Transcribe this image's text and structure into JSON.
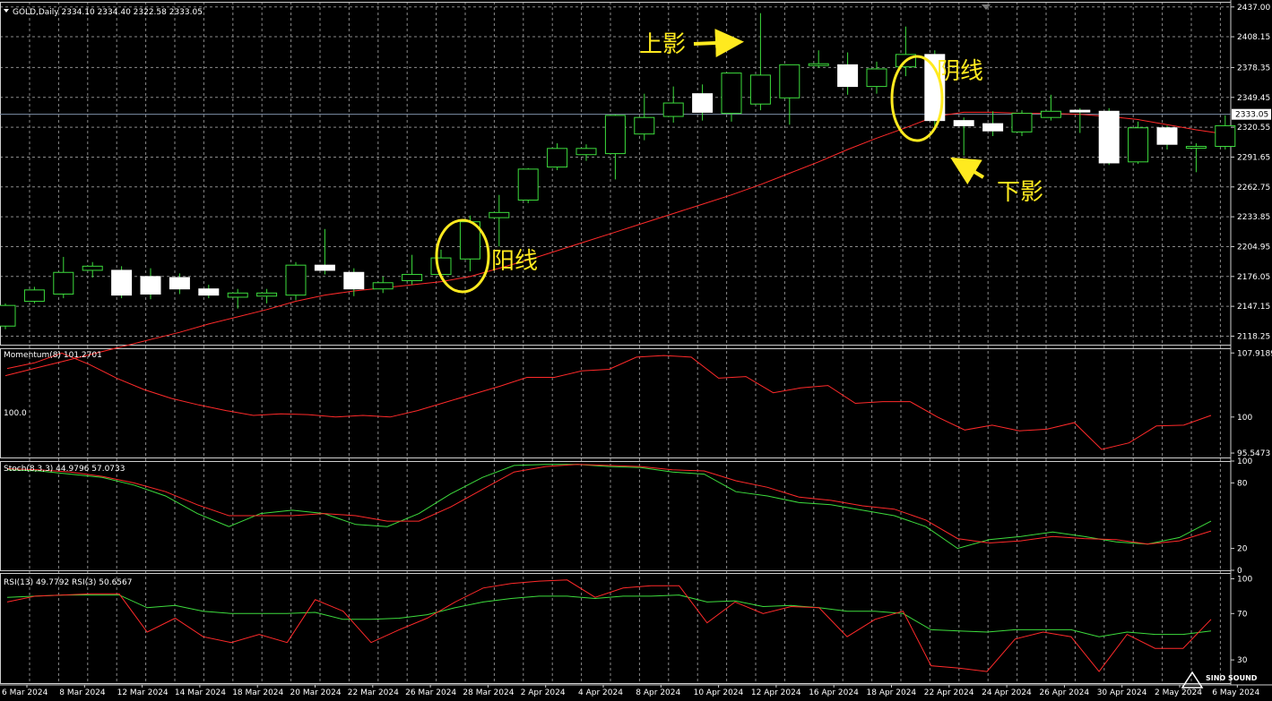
{
  "watermark": "SINO SOUND",
  "chart_data": [
    {
      "type": "candlestick",
      "title": "GOLD,Daily  2334.10 2334.40 2322.58 2333.05",
      "current_price": 2333.05,
      "current_price_label": "2333.05",
      "ylim": [
        2110,
        2442
      ],
      "yticks": [
        "2437.00",
        "2408.15",
        "2378.35",
        "2349.45",
        "2320.55",
        "2291.65",
        "2262.75",
        "2233.85",
        "2204.95",
        "2176.05",
        "2147.15",
        "2118.25"
      ],
      "x_labels": [
        "6 Mar 2024",
        "8 Mar 2024",
        "12 Mar 2024",
        "14 Mar 2024",
        "18 Mar 2024",
        "20 Mar 2024",
        "22 Mar 2024",
        "26 Mar 2024",
        "28 Mar 2024",
        "2 Apr 2024",
        "4 Apr 2024",
        "8 Apr 2024",
        "10 Apr 2024",
        "12 Apr 2024",
        "16 Apr 2024",
        "18 Apr 2024",
        "22 Apr 2024",
        "24 Apr 2024",
        "26 Apr 2024",
        "30 Apr 2024",
        "2 May 2024",
        "6 May 2024"
      ],
      "candles": [
        {
          "o": 2128,
          "h": 2150,
          "l": 2125,
          "c": 2148
        },
        {
          "o": 2152,
          "h": 2166,
          "l": 2150,
          "c": 2163
        },
        {
          "o": 2159,
          "h": 2195,
          "l": 2155,
          "c": 2180
        },
        {
          "o": 2182,
          "h": 2190,
          "l": 2175,
          "c": 2186
        },
        {
          "o": 2182,
          "h": 2186,
          "l": 2155,
          "c": 2158
        },
        {
          "o": 2176,
          "h": 2184,
          "l": 2154,
          "c": 2159
        },
        {
          "o": 2175,
          "h": 2179,
          "l": 2159,
          "c": 2164
        },
        {
          "o": 2164,
          "h": 2168,
          "l": 2155,
          "c": 2158
        },
        {
          "o": 2156,
          "h": 2164,
          "l": 2145,
          "c": 2160
        },
        {
          "o": 2157,
          "h": 2164,
          "l": 2150,
          "c": 2160
        },
        {
          "o": 2158,
          "h": 2190,
          "l": 2153,
          "c": 2187
        },
        {
          "o": 2187,
          "h": 2222,
          "l": 2178,
          "c": 2182
        },
        {
          "o": 2180,
          "h": 2184,
          "l": 2157,
          "c": 2164
        },
        {
          "o": 2164,
          "h": 2176,
          "l": 2160,
          "c": 2170
        },
        {
          "o": 2172,
          "h": 2197,
          "l": 2168,
          "c": 2178
        },
        {
          "o": 2178,
          "h": 2202,
          "l": 2175,
          "c": 2194
        },
        {
          "o": 2193,
          "h": 2235,
          "l": 2181,
          "c": 2229
        },
        {
          "o": 2233,
          "h": 2255,
          "l": 2205,
          "c": 2238
        },
        {
          "o": 2250,
          "h": 2281,
          "l": 2247,
          "c": 2280
        },
        {
          "o": 2282,
          "h": 2305,
          "l": 2279,
          "c": 2300
        },
        {
          "o": 2294,
          "h": 2304,
          "l": 2288,
          "c": 2300
        },
        {
          "o": 2295,
          "h": 2333,
          "l": 2270,
          "c": 2332
        },
        {
          "o": 2314,
          "h": 2353,
          "l": 2308,
          "c": 2330
        },
        {
          "o": 2331,
          "h": 2360,
          "l": 2325,
          "c": 2344
        },
        {
          "o": 2353,
          "h": 2362,
          "l": 2327,
          "c": 2335
        },
        {
          "o": 2334,
          "h": 2372,
          "l": 2326,
          "c": 2373
        },
        {
          "o": 2343,
          "h": 2431,
          "l": 2337,
          "c": 2371
        },
        {
          "o": 2349,
          "h": 2372,
          "l": 2323,
          "c": 2381
        },
        {
          "o": 2381,
          "h": 2395,
          "l": 2378,
          "c": 2382
        },
        {
          "o": 2381,
          "h": 2393,
          "l": 2352,
          "c": 2360
        },
        {
          "o": 2360,
          "h": 2384,
          "l": 2353,
          "c": 2377
        },
        {
          "o": 2379,
          "h": 2418,
          "l": 2370,
          "c": 2391
        },
        {
          "o": 2391,
          "h": 2395,
          "l": 2321,
          "c": 2327
        },
        {
          "o": 2327,
          "h": 2330,
          "l": 2293,
          "c": 2322
        },
        {
          "o": 2324,
          "h": 2336,
          "l": 2312,
          "c": 2317
        },
        {
          "o": 2316,
          "h": 2337,
          "l": 2312,
          "c": 2334
        },
        {
          "o": 2330,
          "h": 2352,
          "l": 2327,
          "c": 2336
        },
        {
          "o": 2337,
          "h": 2339,
          "l": 2315,
          "c": 2336
        },
        {
          "o": 2336,
          "h": 2339,
          "l": 2284,
          "c": 2286
        },
        {
          "o": 2287,
          "h": 2326,
          "l": 2285,
          "c": 2320
        },
        {
          "o": 2320,
          "h": 2322,
          "l": 2299,
          "c": 2304
        },
        {
          "o": 2302,
          "h": 2305,
          "l": 2277,
          "c": 2302
        },
        {
          "o": 2302,
          "h": 2332,
          "l": 2299,
          "c": 2322
        }
      ],
      "ma_color": "#ff2a2a",
      "ma": [
        2080,
        2087,
        2094,
        2101,
        2108,
        2115,
        2122,
        2130,
        2137,
        2144,
        2152,
        2158,
        2162,
        2165,
        2168,
        2171,
        2176,
        2184,
        2192,
        2201,
        2210,
        2219,
        2228,
        2237,
        2246,
        2255,
        2265,
        2276,
        2287,
        2299,
        2310,
        2320,
        2331,
        2335,
        2335,
        2334,
        2334,
        2333,
        2331,
        2328,
        2323,
        2318,
        2314
      ],
      "annotations": {
        "bull_candle": "阳线",
        "bear_candle": "阴线",
        "upper_shadow": "上影",
        "lower_shadow": "下影"
      }
    },
    {
      "type": "line",
      "title": "Momentum(8) 101.2701",
      "level_label": "100.0",
      "ylim": [
        95.0,
        108.5
      ],
      "yticks": [
        "107.9189",
        "100",
        "95.5473"
      ],
      "series": [
        {
          "color": "#ff2a2a",
          "values": [
            106.0,
            106.7,
            107.9,
            106.5,
            104.8,
            103.4,
            102.3,
            101.5,
            100.8,
            100.2,
            100.4,
            100.3,
            100.0,
            100.2,
            100.0,
            100.8,
            101.8,
            102.8,
            103.8,
            104.9,
            104.9,
            105.7,
            105.9,
            107.4,
            107.6,
            107.4,
            104.8,
            105.0,
            103.0,
            103.6,
            103.9,
            101.7,
            101.9,
            101.9,
            100.0,
            98.4,
            99.0,
            98.3,
            98.5,
            99.3,
            96.0,
            96.8,
            98.9,
            99.0,
            100.2
          ]
        }
      ]
    },
    {
      "type": "line",
      "title": "Stoch(8,3,3) 44.9796 57.0733",
      "ylim": [
        0,
        100
      ],
      "yticks": [
        "100",
        "80",
        "20",
        "0"
      ],
      "series": [
        {
          "color": "#3ddc3d",
          "values": [
            92,
            91,
            88,
            85,
            78,
            68,
            52,
            40,
            52,
            55,
            52,
            42,
            40,
            52,
            70,
            85,
            96,
            97,
            97,
            95,
            94,
            90,
            88,
            72,
            68,
            62,
            60,
            55,
            50,
            40,
            20,
            28,
            31,
            35,
            31,
            26,
            24,
            30,
            45
          ]
        },
        {
          "color": "#ff2a2a",
          "values": [
            93,
            92,
            90,
            86,
            80,
            72,
            60,
            50,
            50,
            50,
            52,
            50,
            45,
            45,
            58,
            74,
            90,
            95,
            97,
            96,
            95,
            92,
            91,
            82,
            76,
            67,
            64,
            59,
            56,
            46,
            29,
            25,
            27,
            31,
            29,
            28,
            24,
            27,
            36
          ]
        }
      ]
    },
    {
      "type": "line",
      "title": "RSI(13) 49.7792  RSI(3) 50.6567",
      "ylim": [
        10,
        105
      ],
      "yticks": [
        "100",
        "70",
        "30"
      ],
      "series": [
        {
          "color": "#3ddc3d",
          "values": [
            84,
            85,
            86,
            86,
            86,
            75,
            77,
            72,
            70,
            70,
            70,
            71,
            65,
            65,
            66,
            69,
            75,
            80,
            83,
            85,
            85,
            83,
            85,
            85,
            86,
            80,
            81,
            76,
            77,
            75,
            72,
            72,
            70,
            56,
            55,
            54,
            56,
            56,
            56,
            50,
            54,
            52,
            52,
            55
          ]
        },
        {
          "color": "#ff2a2a",
          "values": [
            80,
            85,
            86,
            87,
            87,
            54,
            66,
            50,
            45,
            52,
            45,
            82,
            72,
            45,
            56,
            66,
            80,
            92,
            96,
            98,
            99,
            84,
            92,
            94,
            94,
            62,
            80,
            70,
            76,
            75,
            50,
            65,
            72,
            25,
            23,
            20,
            48,
            54,
            50,
            20,
            52,
            40,
            40,
            65
          ]
        }
      ]
    }
  ]
}
